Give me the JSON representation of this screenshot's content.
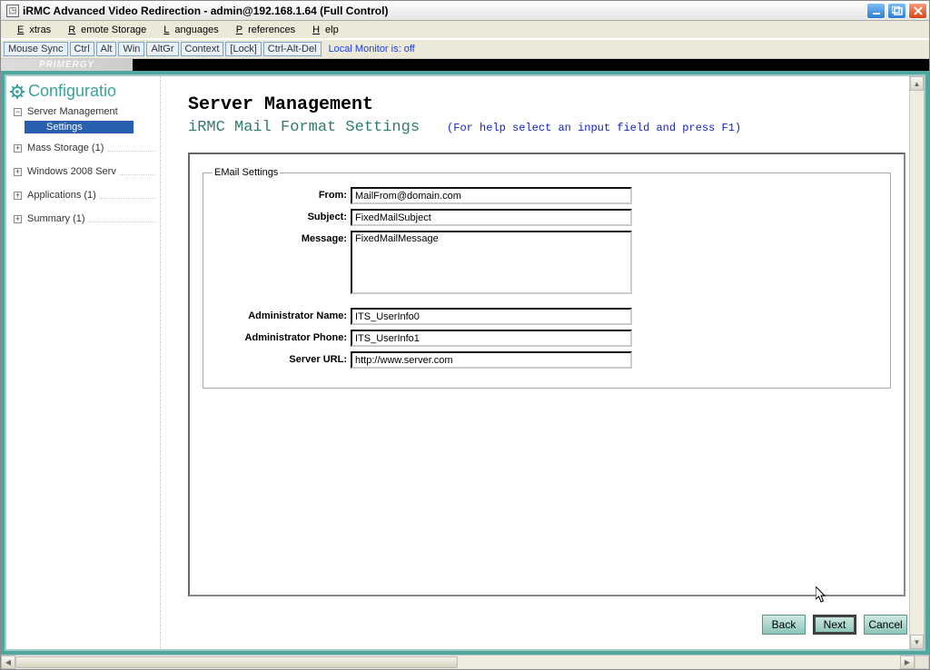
{
  "window": {
    "title": "iRMC Advanced Video Redirection - admin@192.168.1.64 (Full Control)"
  },
  "menubar": [
    "Extras",
    "Remote Storage",
    "Languages",
    "Preferences",
    "Help"
  ],
  "toolbar": {
    "buttons": [
      "Mouse Sync",
      "Ctrl",
      "Alt",
      "Win",
      "AltGr",
      "Context",
      "[Lock]",
      "Ctrl-Alt-Del"
    ],
    "status": "Local Monitor is: off"
  },
  "strip": {
    "primergy": "PRIMERGY"
  },
  "sidebar": {
    "title": "Configuratio",
    "items": [
      {
        "exp": "-",
        "label": "Server Management"
      },
      {
        "selected": true,
        "label": "Settings"
      },
      {
        "exp": "+",
        "label": "Mass Storage (1)"
      },
      {
        "exp": "+",
        "label": "Windows 2008 Serv"
      },
      {
        "exp": "+",
        "label": "Applications (1)"
      },
      {
        "exp": "+",
        "label": "Summary (1)"
      }
    ]
  },
  "main": {
    "heading": "Server Management",
    "subheading": "iRMC Mail Format Settings",
    "help": "(For help select an input field and press F1)",
    "fieldset_legend": "EMail Settings",
    "fields": {
      "from_label": "From:",
      "from_value": "MailFrom@domain.com",
      "subject_label": "Subject:",
      "subject_value": "FixedMailSubject",
      "message_label": "Message:",
      "message_value": "FixedMailMessage",
      "admin_name_label": "Administrator Name:",
      "admin_name_value": "ITS_UserInfo0",
      "admin_phone_label": "Administrator Phone:",
      "admin_phone_value": "ITS_UserInfo1",
      "server_url_label": "Server URL:",
      "server_url_value": "http://www.server.com"
    },
    "buttons": {
      "back": "Back",
      "next": "Next",
      "cancel": "Cancel"
    }
  }
}
